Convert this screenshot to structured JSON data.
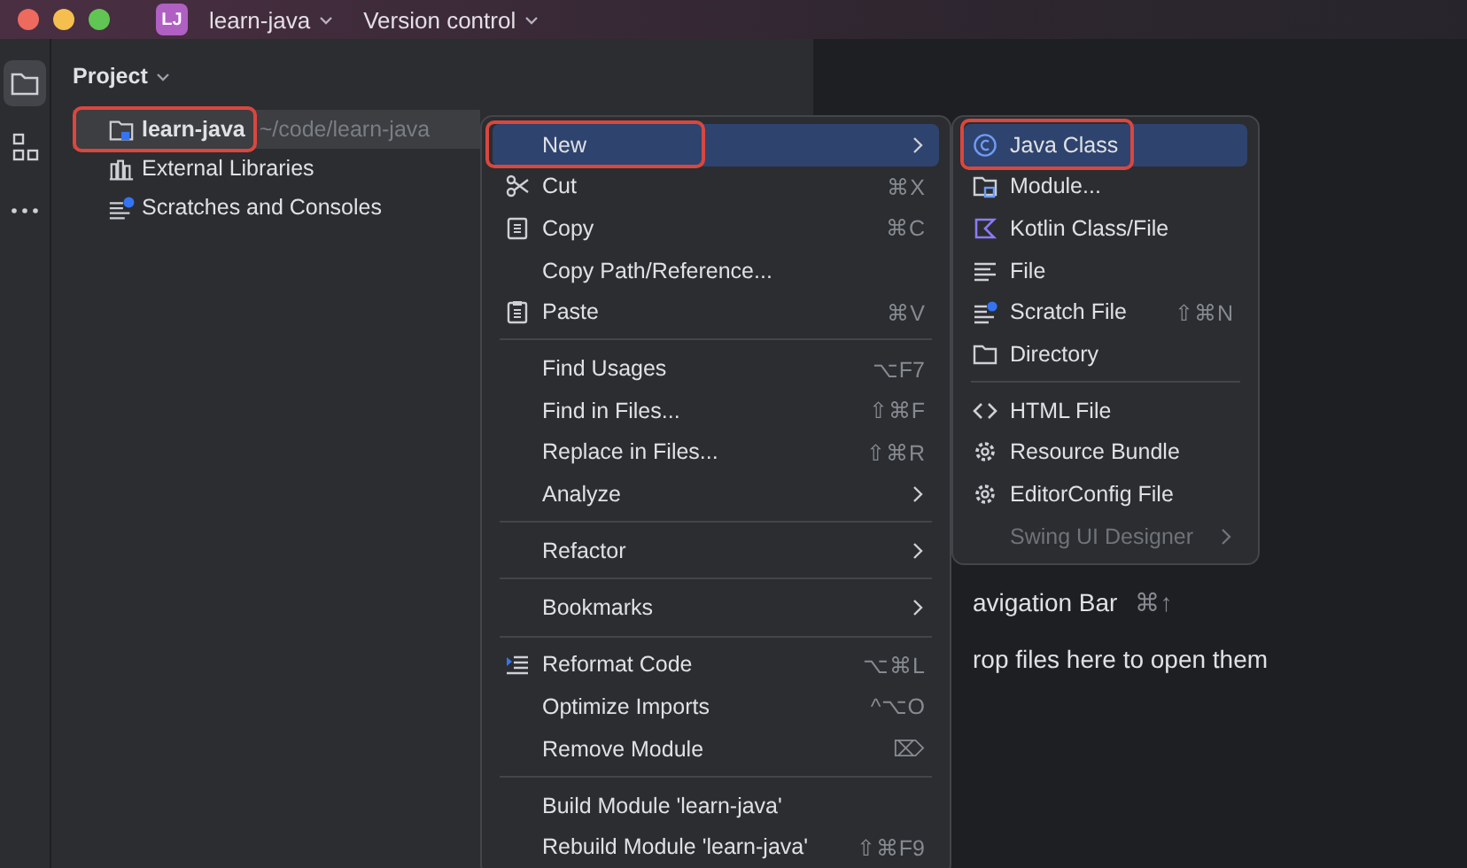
{
  "titlebar": {
    "project_badge": "LJ",
    "project": "learn-java",
    "vcs": "Version control"
  },
  "project_panel": {
    "title": "Project",
    "tree": [
      {
        "label": "learn-java",
        "path": "~/code/learn-java",
        "selected": true,
        "highlighted": true
      },
      {
        "label": "External Libraries",
        "selected": false,
        "highlighted": false
      },
      {
        "label": "Scratches and Consoles",
        "selected": false,
        "highlighted": false
      }
    ]
  },
  "editor": {
    "hints": [
      {
        "text": "avigation Bar",
        "shortcut": "⌘↑"
      },
      {
        "text": "rop files here to open them"
      }
    ]
  },
  "context_menu": {
    "groups": [
      [
        {
          "label": "New",
          "selected": true,
          "highlighted": true,
          "submenu": true
        },
        {
          "label": "Cut",
          "shortcut": "⌘X",
          "selected": false,
          "highlighted": false,
          "submenu": false
        },
        {
          "label": "Copy",
          "shortcut": "⌘C",
          "selected": false,
          "highlighted": false,
          "submenu": false
        },
        {
          "label": "Copy Path/Reference...",
          "selected": false,
          "highlighted": false,
          "submenu": false
        },
        {
          "label": "Paste",
          "shortcut": "⌘V",
          "selected": false,
          "highlighted": false,
          "submenu": false
        }
      ],
      [
        {
          "label": "Find Usages",
          "shortcut": "⌥F7",
          "selected": false,
          "highlighted": false,
          "submenu": false
        },
        {
          "label": "Find in Files...",
          "shortcut": "⇧⌘F",
          "selected": false,
          "highlighted": false,
          "submenu": false
        },
        {
          "label": "Replace in Files...",
          "shortcut": "⇧⌘R",
          "selected": false,
          "highlighted": false,
          "submenu": false
        },
        {
          "label": "Analyze",
          "selected": false,
          "highlighted": false,
          "submenu": true
        }
      ],
      [
        {
          "label": "Refactor",
          "selected": false,
          "highlighted": false,
          "submenu": true
        }
      ],
      [
        {
          "label": "Bookmarks",
          "selected": false,
          "highlighted": false,
          "submenu": true
        }
      ],
      [
        {
          "label": "Reformat Code",
          "shortcut": "⌥⌘L",
          "selected": false,
          "highlighted": false,
          "submenu": false
        },
        {
          "label": "Optimize Imports",
          "shortcut": "^⌥O",
          "selected": false,
          "highlighted": false,
          "submenu": false
        },
        {
          "label": "Remove Module",
          "shortcut": "⌦",
          "selected": false,
          "highlighted": false,
          "submenu": false
        }
      ],
      [
        {
          "label": "Build Module 'learn-java'",
          "selected": false,
          "highlighted": false,
          "submenu": false
        },
        {
          "label": "Rebuild Module 'learn-java'",
          "shortcut": "⇧⌘F9",
          "selected": false,
          "highlighted": false,
          "submenu": false
        }
      ]
    ]
  },
  "new_submenu": {
    "groups": [
      [
        {
          "label": "Java Class",
          "selected": true,
          "highlighted": true,
          "disabled": false,
          "submenu": false
        },
        {
          "label": "Module...",
          "selected": false,
          "highlighted": false,
          "disabled": false,
          "submenu": false
        },
        {
          "label": "Kotlin Class/File",
          "selected": false,
          "highlighted": false,
          "disabled": false,
          "submenu": false
        },
        {
          "label": "File",
          "selected": false,
          "highlighted": false,
          "disabled": false,
          "submenu": false
        },
        {
          "label": "Scratch File",
          "shortcut": "⇧⌘N",
          "selected": false,
          "highlighted": false,
          "disabled": false,
          "submenu": false
        },
        {
          "label": "Directory",
          "selected": false,
          "highlighted": false,
          "disabled": false,
          "submenu": false
        }
      ],
      [
        {
          "label": "HTML File",
          "selected": false,
          "highlighted": false,
          "disabled": false,
          "submenu": false
        },
        {
          "label": "Resource Bundle",
          "selected": false,
          "highlighted": false,
          "disabled": false,
          "submenu": false
        },
        {
          "label": "EditorConfig File",
          "selected": false,
          "highlighted": false,
          "disabled": false,
          "submenu": false
        },
        {
          "label": "Swing UI Designer",
          "selected": false,
          "highlighted": false,
          "disabled": true,
          "submenu": true
        }
      ]
    ]
  }
}
